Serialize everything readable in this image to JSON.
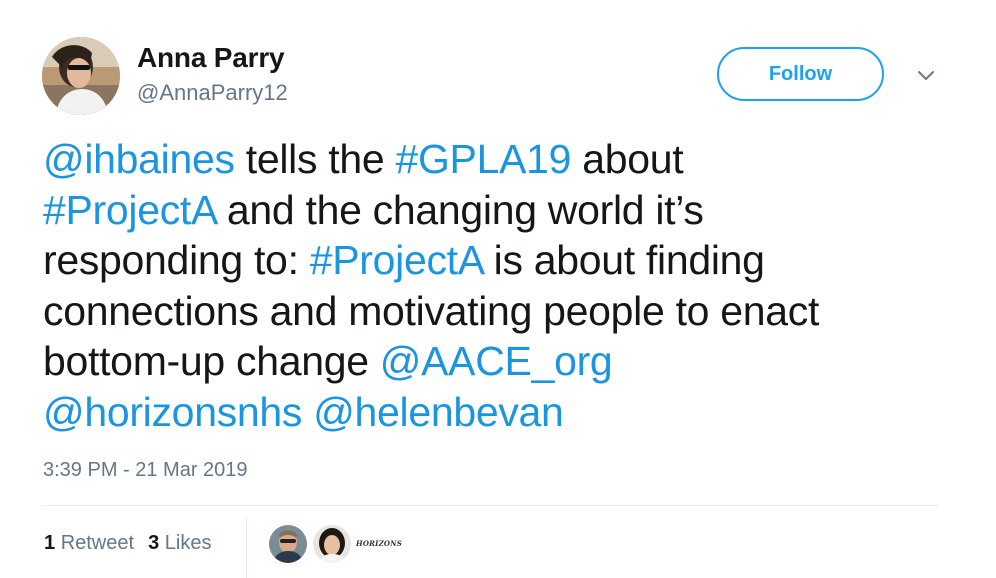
{
  "tweet": {
    "author": {
      "name": "Anna Parry",
      "handle": "@AnnaParry12"
    },
    "follow_label": "Follow",
    "body": [
      [
        {
          "t": "@ihbaines",
          "link": true
        },
        {
          "t": " tells the "
        },
        {
          "t": "#GPLA19",
          "link": true
        },
        {
          "t": " about"
        }
      ],
      [
        {
          "t": "#ProjectA",
          "link": true
        },
        {
          "t": " and the changing world it’s"
        }
      ],
      [
        {
          "t": "responding to: "
        },
        {
          "t": "#ProjectA",
          "link": true
        },
        {
          "t": " is about finding"
        }
      ],
      [
        {
          "t": "connections and motivating people to enact"
        }
      ],
      [
        {
          "t": "bottom-up change "
        },
        {
          "t": "@AACE_org",
          "link": true
        }
      ],
      [
        {
          "t": "@horizonsnhs",
          "link": true
        },
        {
          "t": " "
        },
        {
          "t": "@helenbevan",
          "link": true
        }
      ]
    ],
    "timestamp": "3:39 PM - 21 Mar 2019",
    "stats": {
      "retweets_count": "1",
      "retweets_label": "Retweet",
      "likes_count": "3",
      "likes_label": "Likes"
    },
    "likers_logo_text": "HORIZONS"
  },
  "colors": {
    "link": "#1b95e0",
    "accent": "#1da1f2",
    "muted": "#657786",
    "text": "#14171a"
  },
  "icons": {
    "menu": "chevron-down-icon"
  }
}
